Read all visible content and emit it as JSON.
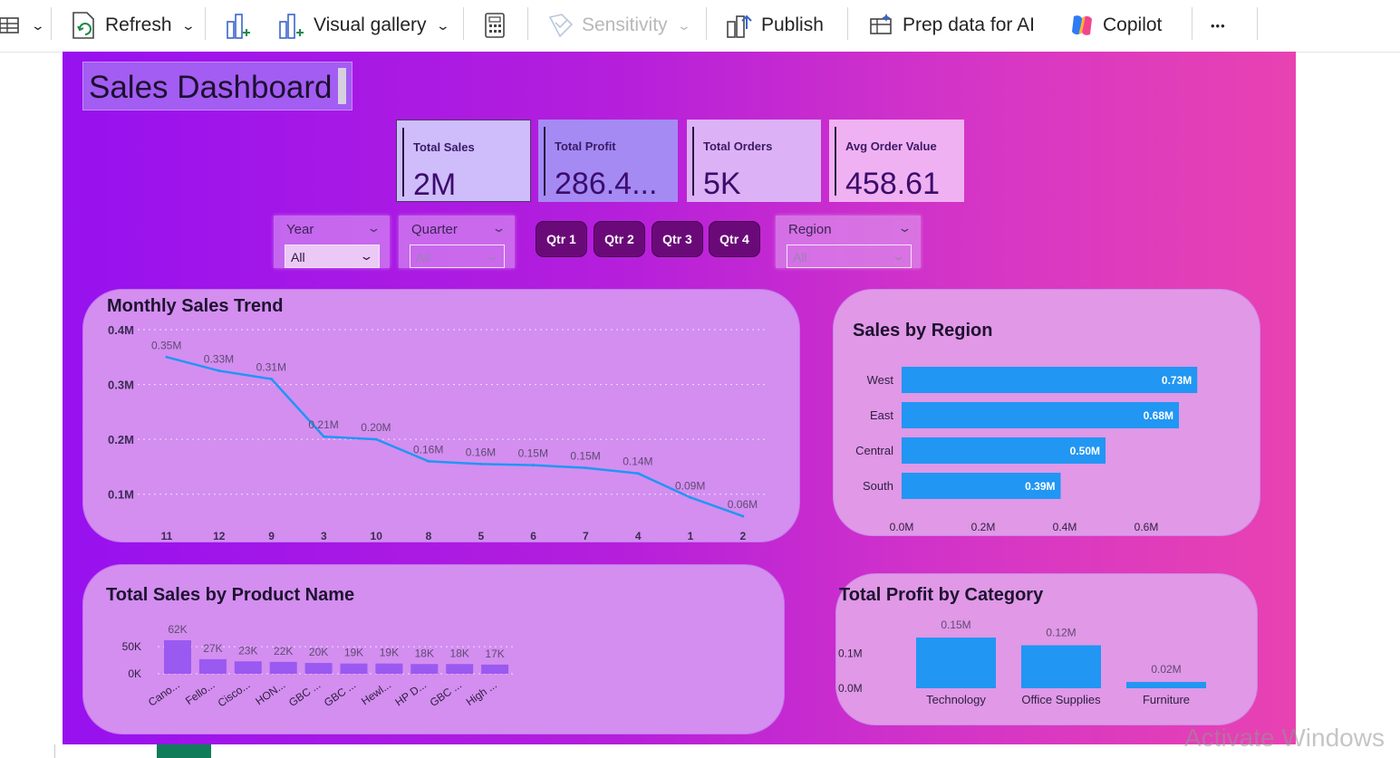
{
  "ribbon": {
    "refresh": "Refresh",
    "visual_gallery": "Visual gallery",
    "sensitivity": "Sensitivity",
    "publish": "Publish",
    "prep_data": "Prep data for AI",
    "copilot": "Copilot",
    "more": "•••"
  },
  "dashboard": {
    "title": "Sales Dashboard",
    "kpis": [
      {
        "label": "Total Sales",
        "value": "2M"
      },
      {
        "label": "Total Profit",
        "value": "286.4..."
      },
      {
        "label": "Total Orders",
        "value": "5K"
      },
      {
        "label": "Avg Order Value",
        "value": "458.61"
      }
    ],
    "slicers": {
      "year": {
        "label": "Year",
        "value": "All"
      },
      "quarter": {
        "label": "Quarter",
        "value": "All"
      },
      "region": {
        "label": "Region",
        "value": "All"
      }
    },
    "quarter_buttons": [
      "Qtr 1",
      "Qtr 2",
      "Qtr 3",
      "Qtr 4"
    ],
    "accent_color": "#2196f3"
  },
  "watermark": "Activate Windows",
  "chart_data": [
    {
      "type": "line",
      "title": "Monthly Sales Trend",
      "categories": [
        "11",
        "12",
        "9",
        "3",
        "10",
        "8",
        "5",
        "6",
        "7",
        "4",
        "1",
        "2"
      ],
      "values": [
        0.35,
        0.325,
        0.31,
        0.205,
        0.2,
        0.16,
        0.155,
        0.153,
        0.148,
        0.138,
        0.094,
        0.06
      ],
      "data_labels": [
        "0.35M",
        "0.33M",
        "0.31M",
        "0.21M",
        "0.20M",
        "0.16M",
        "0.16M",
        "0.15M",
        "0.15M",
        "0.14M",
        "0.09M",
        "0.06M"
      ],
      "yticks": [
        "0.1M",
        "0.2M",
        "0.3M",
        "0.4M"
      ],
      "ytick_values": [
        0.1,
        0.2,
        0.3,
        0.4
      ],
      "ylim": [
        0.05,
        0.4
      ],
      "grid": true
    },
    {
      "type": "bar",
      "orientation": "horizontal",
      "title": "Sales by Region",
      "categories": [
        "West",
        "East",
        "Central",
        "South"
      ],
      "values": [
        0.725,
        0.68,
        0.5,
        0.39
      ],
      "data_labels": [
        "0.73M",
        "0.68M",
        "0.50M",
        "0.39M"
      ],
      "xticks": [
        "0.0M",
        "0.2M",
        "0.4M",
        "0.6M"
      ],
      "xtick_values": [
        0,
        0.2,
        0.4,
        0.6
      ],
      "xlim": [
        0,
        0.75
      ]
    },
    {
      "type": "bar",
      "title": "Total Sales by Product Name",
      "categories": [
        "Cano...",
        "Fello...",
        "Cisco...",
        "HON...",
        "GBC ...",
        "GBC ...",
        "Hewl...",
        "HP D...",
        "GBC ...",
        "High ..."
      ],
      "values": [
        62,
        27,
        23,
        22,
        20,
        19,
        19,
        18,
        18,
        17
      ],
      "data_labels": [
        "62K",
        "27K",
        "23K",
        "22K",
        "20K",
        "19K",
        "19K",
        "18K",
        "18K",
        "17K"
      ],
      "yticks": [
        "0K",
        "50K"
      ],
      "ytick_values": [
        0,
        50
      ],
      "ylim": [
        0,
        62
      ]
    },
    {
      "type": "bar",
      "title": "Total Profit by Category",
      "categories": [
        "Technology",
        "Office Supplies",
        "Furniture"
      ],
      "values": [
        0.145,
        0.123,
        0.018
      ],
      "data_labels": [
        "0.15M",
        "0.12M",
        "0.02M"
      ],
      "yticks": [
        "0.0M",
        "0.1M"
      ],
      "ytick_values": [
        0,
        0.1
      ],
      "ylim": [
        0,
        0.145
      ]
    }
  ]
}
